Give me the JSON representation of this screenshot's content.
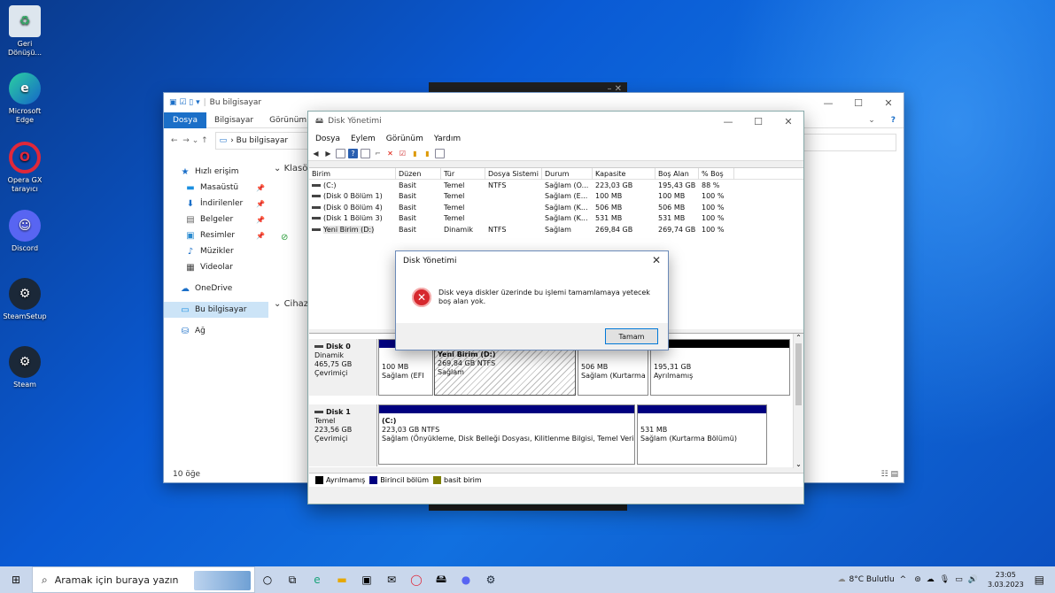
{
  "desktop": {
    "icons": [
      {
        "label": "Geri Dönüşü...",
        "color": "#9ab"
      },
      {
        "label": "Microsoft Edge",
        "color": "#1aa37a"
      },
      {
        "label": "Opera GX tarayıcı",
        "color": "#e0283a"
      },
      {
        "label": "Discord",
        "color": "#5865f2"
      },
      {
        "label": "SteamSetup",
        "color": "#1b2838"
      },
      {
        "label": "Steam",
        "color": "#1b2838"
      }
    ]
  },
  "explorer": {
    "title": "Bu bilgisayar",
    "ribbon": [
      "Dosya",
      "Bilgisayar",
      "Görünüm"
    ],
    "address": "Bu bilgisayar",
    "nav": [
      {
        "label": "Hızlı erişim",
        "icon": "star-icon"
      },
      {
        "label": "Masaüstü",
        "icon": "desktop-icon",
        "pinned": true
      },
      {
        "label": "İndirilenler",
        "icon": "download-icon",
        "pinned": true
      },
      {
        "label": "Belgeler",
        "icon": "document-icon",
        "pinned": true
      },
      {
        "label": "Resimler",
        "icon": "picture-icon",
        "pinned": true
      },
      {
        "label": "Müzikler",
        "icon": "music-icon"
      },
      {
        "label": "Videolar",
        "icon": "video-icon"
      },
      {
        "label": "OneDrive",
        "icon": "cloud-icon"
      },
      {
        "label": "Bu bilgisayar",
        "icon": "computer-icon"
      },
      {
        "label": "Ağ",
        "icon": "network-icon"
      }
    ],
    "section_folders": "Klasö",
    "section_devices": "Cihaz",
    "status": "10 öğe"
  },
  "diskmgmt": {
    "title": "Disk Yönetimi",
    "menu": [
      "Dosya",
      "Eylem",
      "Görünüm",
      "Yardım"
    ],
    "columns": [
      "Birim",
      "Düzen",
      "Tür",
      "Dosya Sistemi",
      "Durum",
      "Kapasite",
      "Boş Alan",
      "% Boş"
    ],
    "volumes": [
      [
        "(C:)",
        "Basit",
        "Temel",
        "NTFS",
        "Sağlam (Ö...",
        "223,03 GB",
        "195,43 GB",
        "88 %"
      ],
      [
        "(Disk 0 Bölüm 1)",
        "Basit",
        "Temel",
        "",
        "Sağlam (E...",
        "100 MB",
        "100 MB",
        "100 %"
      ],
      [
        "(Disk 0 Bölüm 4)",
        "Basit",
        "Temel",
        "",
        "Sağlam (K...",
        "506 MB",
        "506 MB",
        "100 %"
      ],
      [
        "(Disk 1 Bölüm 3)",
        "Basit",
        "Temel",
        "",
        "Sağlam (K...",
        "531 MB",
        "531 MB",
        "100 %"
      ],
      [
        "Yeni Birim (D:)",
        "Basit",
        "Dinamik",
        "NTFS",
        "Sağlam",
        "269,84 GB",
        "269,74 GB",
        "100 %"
      ]
    ],
    "disk0": {
      "name": "Disk 0",
      "type": "Dinamik",
      "size": "465,75 GB",
      "state": "Çevrimiçi",
      "p1_size": "100 MB",
      "p1_state": "Sağlam (EFI",
      "p2_name": "Yeni Birim  (D:)",
      "p2_size": "269,84 GB NTFS",
      "p2_state": "Sağlam",
      "p3_size": "506 MB",
      "p3_state": "Sağlam (Kurtarma",
      "p4_size": "195,31 GB",
      "p4_state": "Ayrılmamış"
    },
    "disk1": {
      "name": "Disk 1",
      "type": "Temel",
      "size": "223,56 GB",
      "state": "Çevrimiçi",
      "p1_name": "(C:)",
      "p1_size": "223,03 GB NTFS",
      "p1_state": "Sağlam (Önyükleme, Disk Belleği Dosyası, Kilitlenme Bilgisi, Temel Veri",
      "p2_size": "531 MB",
      "p2_state": "Sağlam (Kurtarma Bölümü)"
    },
    "legend": [
      "Ayrılmamış",
      "Birincil bölüm",
      "basit birim"
    ],
    "colors": {
      "unallocated": "#000000",
      "primary": "#00007f",
      "simple": "#7f7f00"
    }
  },
  "dialog": {
    "title": "Disk Yönetimi",
    "message": "Disk veya diskler üzerinde bu işlemi tamamlamaya yetecek boş alan yok.",
    "ok": "Tamam"
  },
  "taskbar": {
    "search_placeholder": "Aramak için buraya yazın",
    "weather": "8°C  Bulutlu",
    "time": "23:05",
    "date": "3.03.2023"
  }
}
